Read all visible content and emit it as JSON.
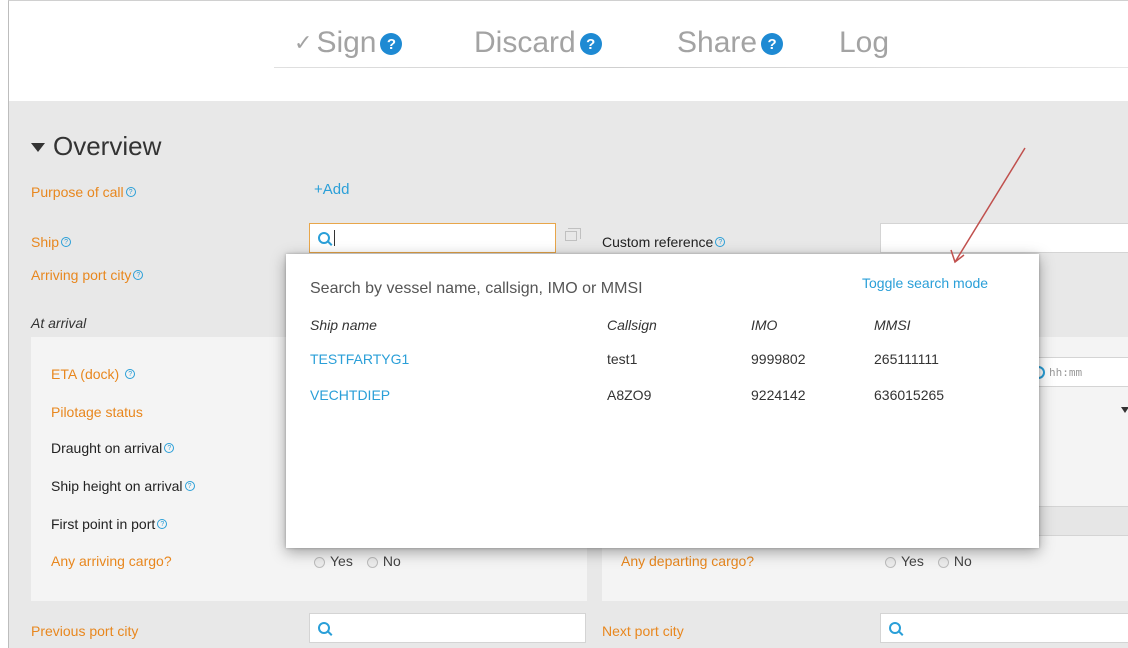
{
  "toolbar": {
    "sign_check": "✓",
    "sign_label": "Sign",
    "discard_label": "Discard",
    "share_label": "Share",
    "log_label": "Log",
    "help_glyph": "?"
  },
  "overview": {
    "title": "Overview",
    "purpose_label": "Purpose of call",
    "add_label": "+Add",
    "ship_label": "Ship",
    "custom_reference_label": "Custom reference",
    "arriving_port_label": "Arriving port city",
    "at_arrival_label": "At arrival",
    "eta_label": "ETA (dock)",
    "pilotage_label": "Pilotage status",
    "draught_label": "Draught on arrival",
    "height_label": "Ship height on arrival",
    "first_point_label": "First point in port",
    "arriving_cargo_label": "Any arriving cargo?",
    "departing_cargo_label": "Any departing cargo?",
    "yes_label": "Yes",
    "no_label": "No",
    "time_placeholder": "hh:mm",
    "previous_port_label": "Previous port city",
    "next_port_label": "Next port city"
  },
  "ship_search": {
    "hint": "Search by vessel name, callsign, IMO or MMSI",
    "toggle_label": "Toggle search mode",
    "columns": [
      "Ship name",
      "Callsign",
      "IMO",
      "MMSI"
    ],
    "rows": [
      {
        "name": "TESTFARTYG1",
        "callsign": "test1",
        "imo": "9999802",
        "mmsi": "265111111"
      },
      {
        "name": "VECHTDIEP",
        "callsign": "A8ZO9",
        "imo": "9224142",
        "mmsi": "636015265"
      }
    ]
  },
  "colors": {
    "accent_blue": "#2a9fd8",
    "label_orange": "#e8871e",
    "annotation_arrow": "#c0504d"
  },
  "icons": [
    "check-icon",
    "help-icon",
    "search-icon",
    "copy-icon",
    "clock-icon",
    "dropdown-arrow-icon",
    "radio-icon",
    "annotation-arrow-icon"
  ]
}
